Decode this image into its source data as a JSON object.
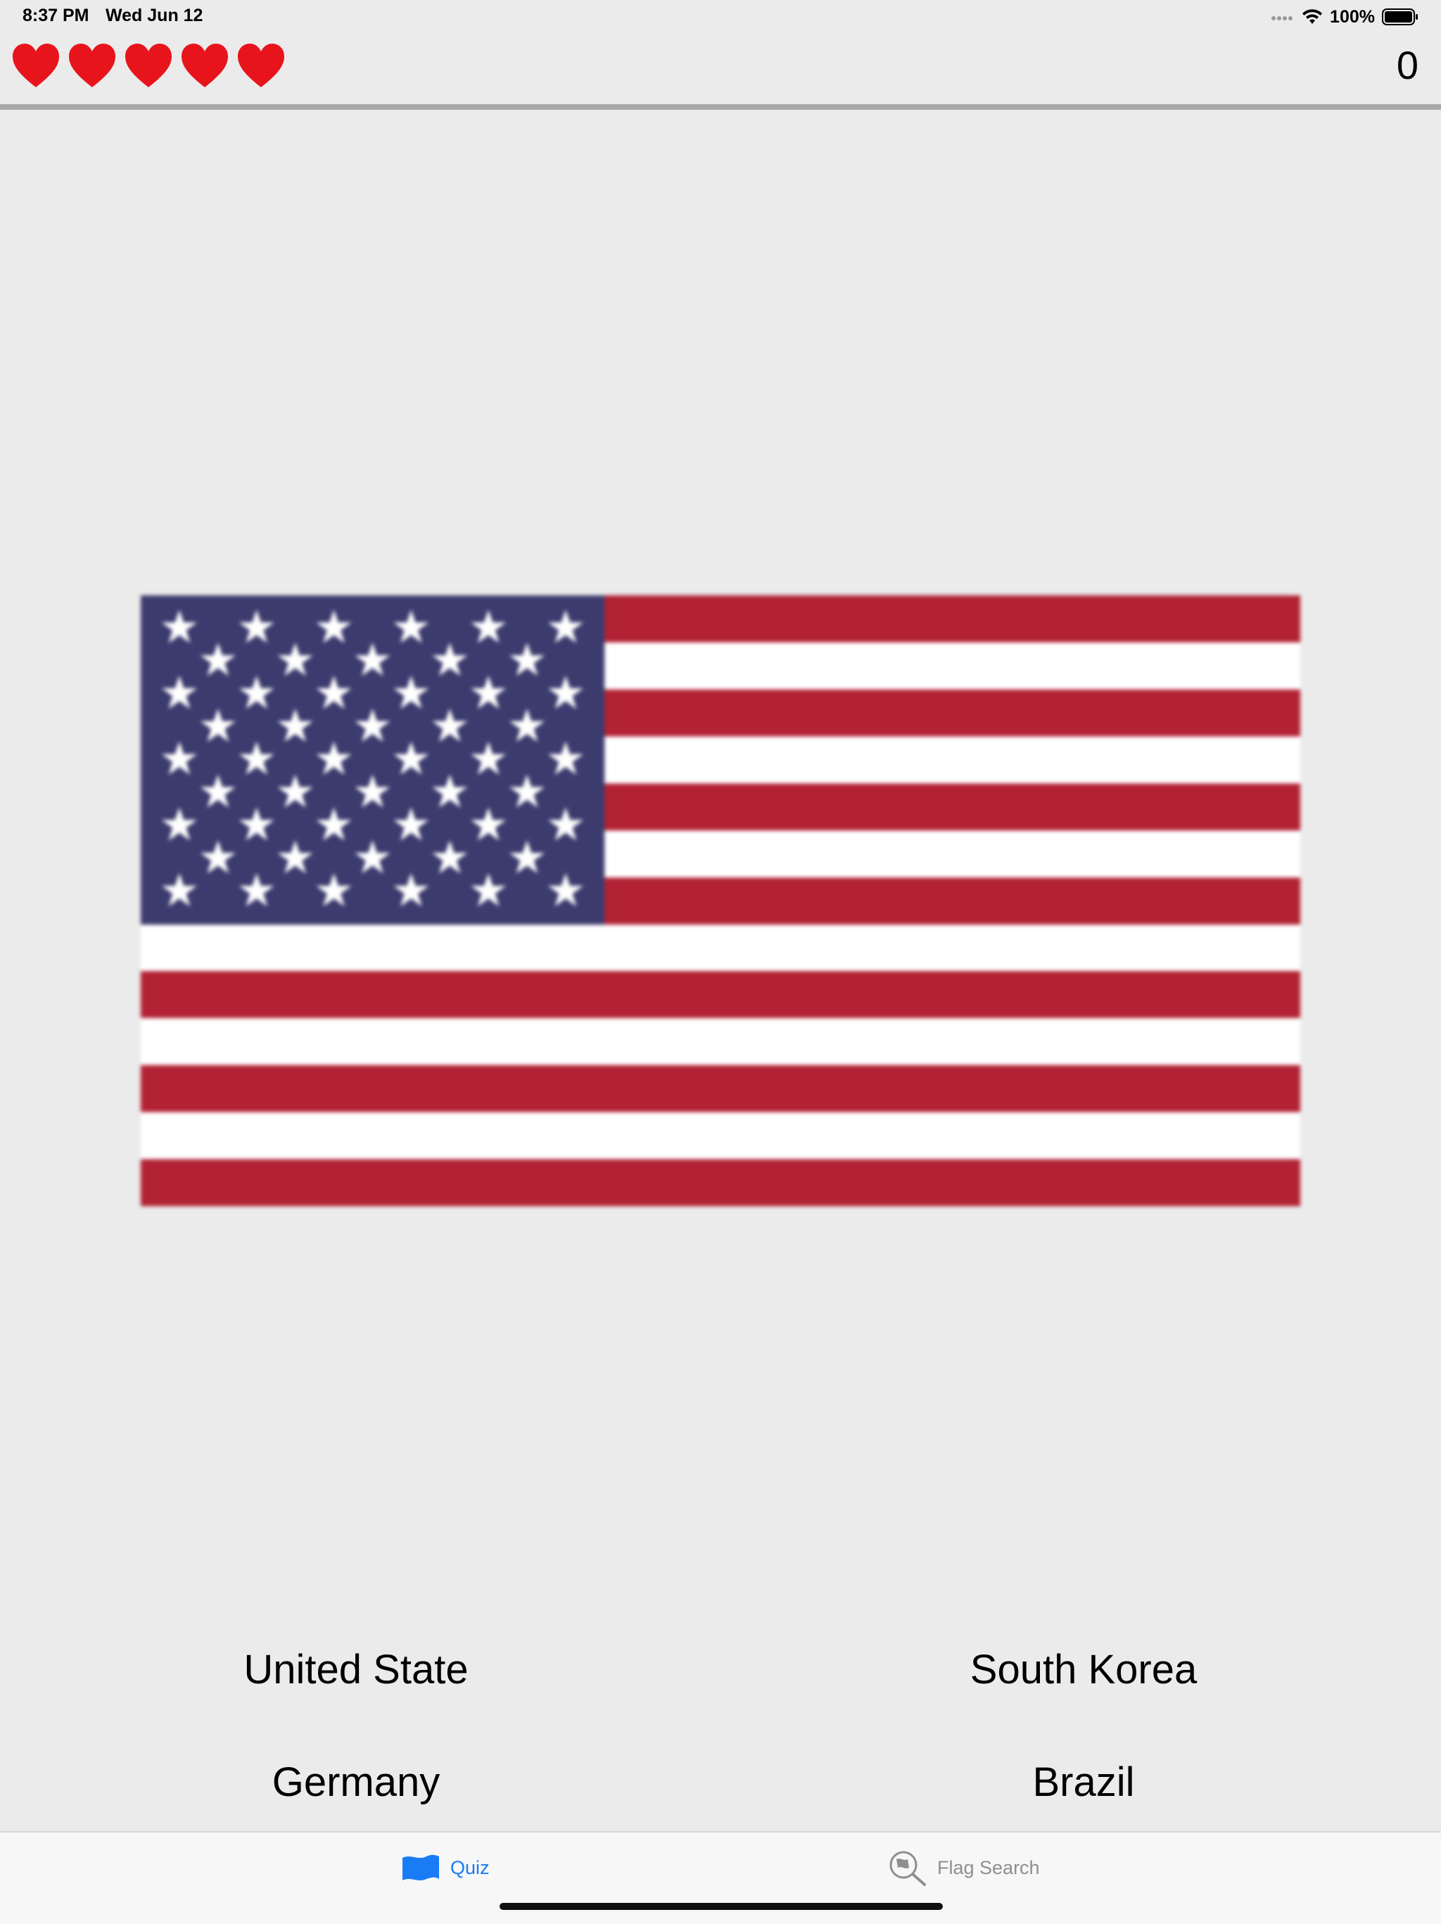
{
  "status_bar": {
    "time": "8:37 PM",
    "date": "Wed Jun 12",
    "battery_percent": "100%"
  },
  "header": {
    "lives": 5,
    "score": "0"
  },
  "quiz": {
    "flag_icon": "united-states-flag",
    "answers": [
      {
        "label": "United State"
      },
      {
        "label": "South Korea"
      },
      {
        "label": "Germany"
      },
      {
        "label": "Brazil"
      }
    ]
  },
  "tab_bar": {
    "tabs": [
      {
        "label": "Quiz",
        "icon": "flag-icon",
        "selected": true
      },
      {
        "label": "Flag Search",
        "icon": "magnifier-flag-icon",
        "selected": false
      }
    ]
  },
  "colors": {
    "background": "#ebebeb",
    "heart": "#e8141c",
    "accent": "#1a7cf5",
    "flag_red": "#b22234",
    "flag_blue": "#3c3b6e",
    "flag_white": "#ffffff"
  }
}
